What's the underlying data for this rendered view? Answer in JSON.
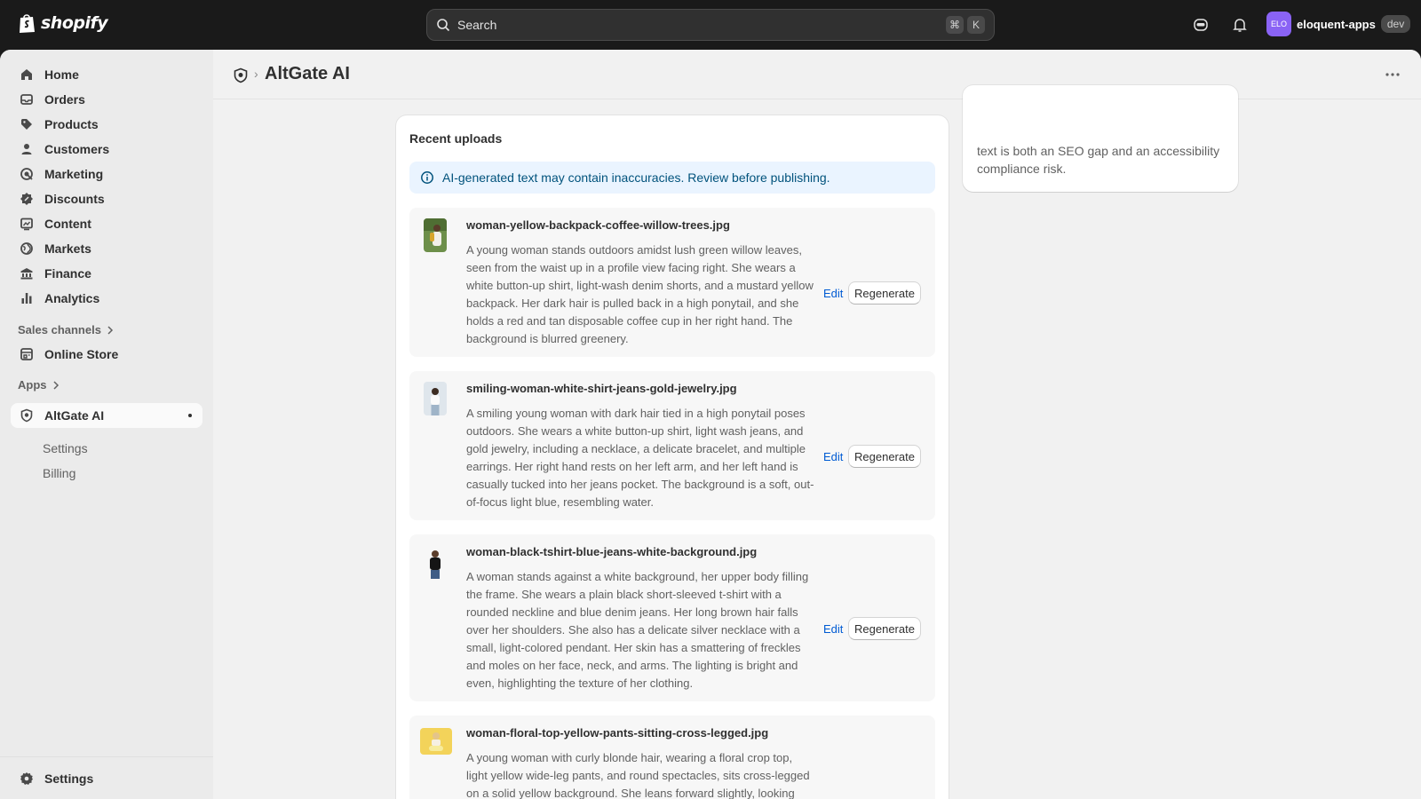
{
  "topbar": {
    "brand": "shopify",
    "search_placeholder": "Search",
    "shortcut_keys": [
      "⌘",
      "K"
    ],
    "store": {
      "initials": "ELO",
      "name": "eloquent-apps",
      "badge": "dev"
    }
  },
  "sidebar": {
    "items": [
      {
        "label": "Home",
        "icon": "home-icon"
      },
      {
        "label": "Orders",
        "icon": "orders-icon"
      },
      {
        "label": "Products",
        "icon": "tag-icon"
      },
      {
        "label": "Customers",
        "icon": "person-icon"
      },
      {
        "label": "Marketing",
        "icon": "target-icon"
      },
      {
        "label": "Discounts",
        "icon": "discount-icon"
      },
      {
        "label": "Content",
        "icon": "content-icon"
      },
      {
        "label": "Markets",
        "icon": "globe-icon"
      },
      {
        "label": "Finance",
        "icon": "bank-icon"
      },
      {
        "label": "Analytics",
        "icon": "chart-bar-icon"
      }
    ],
    "sales_channels_label": "Sales channels",
    "online_store_label": "Online Store",
    "apps_label": "Apps",
    "app": {
      "label": "AltGate AI",
      "sub": [
        "Settings",
        "Billing"
      ]
    },
    "settings_label": "Settings"
  },
  "page": {
    "title": "AltGate AI",
    "side_card_text": "text is both an SEO gap and an accessibility compliance risk.",
    "uploads_title": "Recent uploads",
    "banner": "AI-generated text may contain inaccuracies. Review before publishing.",
    "edit_label": "Edit",
    "regenerate_label": "Regenerate",
    "uploads": [
      {
        "filename": "woman-yellow-backpack-coffee-willow-trees.jpg",
        "description": "A young woman stands outdoors amidst lush green willow leaves, seen from the waist up in a profile view facing right. She wears a white button-up shirt, light-wash denim shorts, and a mustard yellow backpack. Her dark hair is pulled back in a high ponytail, and she holds a red and tan disposable coffee cup in her right hand. The background is blurred greenery."
      },
      {
        "filename": "smiling-woman-white-shirt-jeans-gold-jewelry.jpg",
        "description": "A smiling young woman with dark hair tied in a high ponytail poses outdoors. She wears a white button-up shirt, light wash jeans, and gold jewelry, including a necklace, a delicate bracelet, and multiple earrings. Her right hand rests on her left arm, and her left hand is casually tucked into her jeans pocket. The background is a soft, out-of-focus light blue, resembling water."
      },
      {
        "filename": "woman-black-tshirt-blue-jeans-white-background.jpg",
        "description": "A woman stands against a white background, her upper body filling the frame. She wears a plain black short-sleeved t-shirt with a rounded neckline and blue denim jeans. Her long brown hair falls over her shoulders. She also has a delicate silver necklace with a small, light-colored pendant. Her skin has a smattering of freckles and moles on her face, neck, and arms. The lighting is bright and even, highlighting the texture of her clothing."
      },
      {
        "filename": "woman-floral-top-yellow-pants-sitting-cross-legged.jpg",
        "description": "A young woman with curly blonde hair, wearing a floral crop top, light yellow wide-leg pants, and round spectacles, sits cross-legged on a solid yellow background. She leans forward slightly, looking"
      }
    ]
  },
  "colors": {
    "topbar": "#1a1a1a",
    "accent": "#005bd3",
    "banner_bg": "#eaf4ff",
    "avatar": "#8a63f5"
  }
}
